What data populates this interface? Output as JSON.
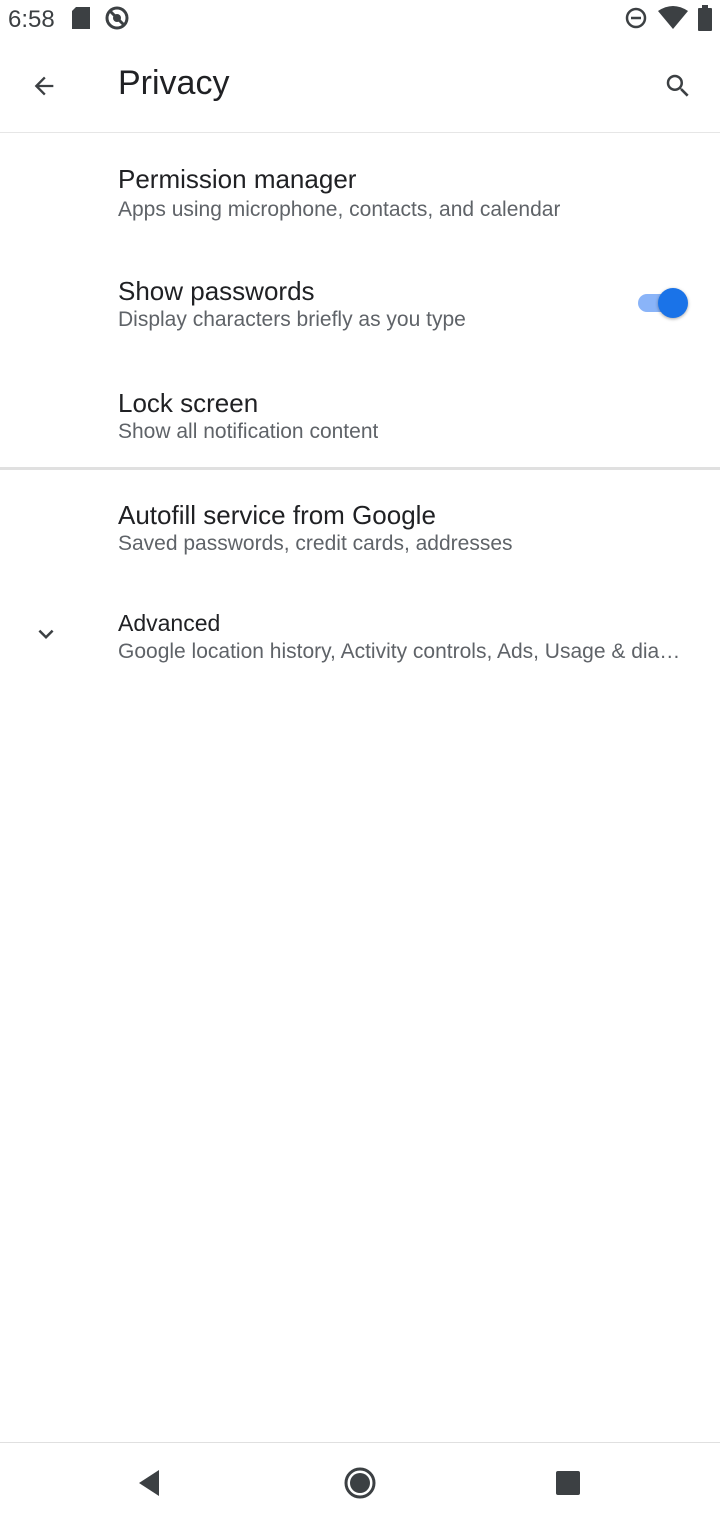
{
  "status_bar": {
    "time": "6:58",
    "left_icons": [
      "sd-card-icon",
      "do-not-disturb-icon"
    ],
    "right_icons": [
      "dnd-minus-icon",
      "wifi-icon",
      "battery-icon"
    ]
  },
  "toolbar": {
    "title": "Privacy",
    "back_icon": "arrow-back-icon",
    "search_icon": "search-icon"
  },
  "preferences": [
    {
      "title": "Permission manager",
      "summary": "Apps using microphone, contacts, and calendar"
    },
    {
      "title": "Show passwords",
      "summary": "Display characters briefly as you type",
      "toggle_on": true
    },
    {
      "title": "Lock screen",
      "summary": "Show all notification content"
    },
    {
      "title": "Autofill service from Google",
      "summary": "Saved passwords, credit cards, addresses"
    },
    {
      "title": "Advanced",
      "summary": "Google location history, Activity controls, Ads, Usage & diagno.."
    }
  ],
  "colors": {
    "accent": "#1a73e8",
    "accent_track": "#8ab4f8",
    "primary_text": "#202124",
    "secondary_text": "#5f6368"
  },
  "nav_bar": {
    "icons": [
      "nav-back-icon",
      "nav-home-icon",
      "nav-recents-icon"
    ]
  }
}
